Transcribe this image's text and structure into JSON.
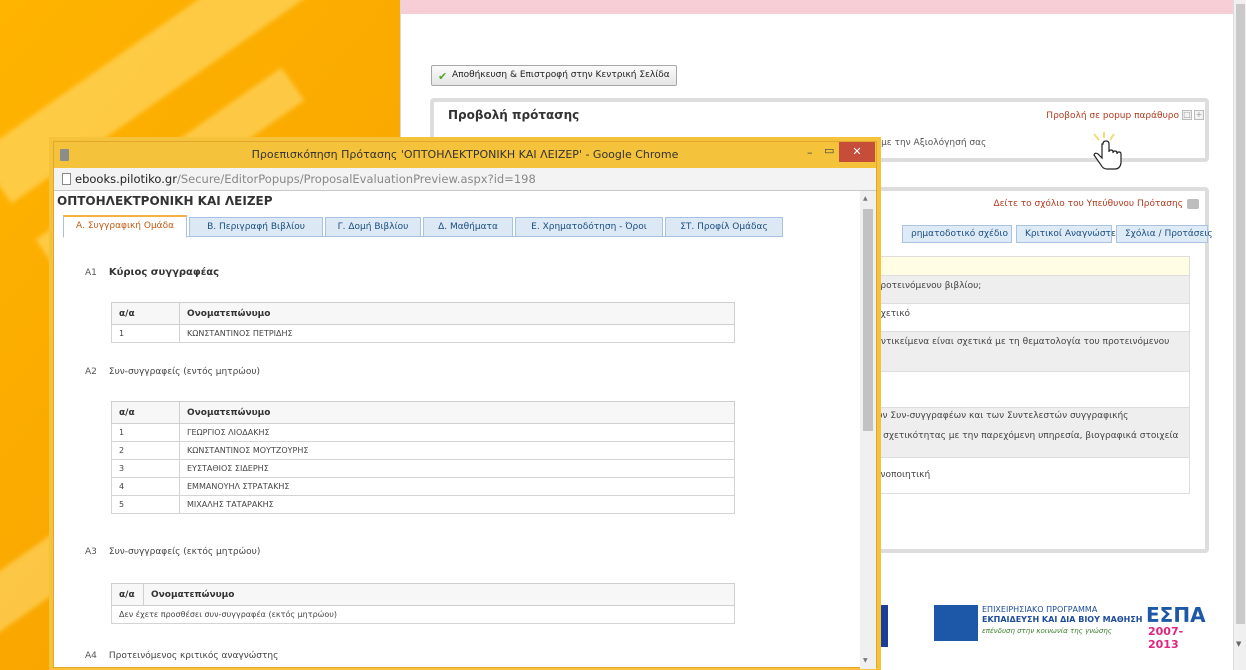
{
  "background_page": {
    "save_button": "Αποθήκευση & Επιστροφή στην Κεντρική Σελίδα",
    "preview_panel": {
      "title": "Προβολή πρότασης",
      "popup_link": "Προβολή σε popup παράθυρο",
      "hint": "Πατήστε εδώ για να δείτε την Πρόταση παράλληλα με την Αξιολόγησή σας"
    },
    "comments_panel": {
      "link": "Δείτε το σχόλιο του Υπεύθυνου Πρότασης",
      "tabs": [
        "ρηματοδοτικό σχέδιο",
        "Κριτικοί Αναγνώστες",
        "Σχόλια / Προτάσεις"
      ],
      "rows": [
        "προτεινόμενου βιβλίου;",
        "σχετικό",
        "αντικείμενα είναι σχετικά με τη θεματολογία του προτεινόμενου",
        "ων Συν-συγγραφέων και των Συντελεστών συγγραφικής",
        "ς σχετικότητας με την παρεχόμενη υπηρεσία, βιογραφικά στοιχεία",
        "ονοποιητική"
      ]
    },
    "footer": {
      "program_line1": "ΕΠΙΧΕΙΡΗΣΙΑΚΟ ΠΡΟΓΡΑΜΜΑ",
      "program_line2": "ΕΚΠΑΙΔΕΥΣΗ ΚΑΙ ΔΙΑ ΒΙΟΥ ΜΑΘΗΣΗ",
      "program_line3": "επένδυση στην κοινωνία της γνώσης",
      "espa_logo": "ΕΣΠΑ",
      "espa_years": "2007-2013"
    }
  },
  "popup": {
    "window_title": "Προεπισκόπηση Πρότασης 'ΟΠΤΟΗΛΕΚΤΡΟΝΙΚΗ ΚΑΙ ΛΕΙΖΕΡ' - Google Chrome",
    "url_domain": "ebooks.pilotiko.gr",
    "url_path": "/Secure/EditorPopups/ProposalEvaluationPreview.aspx?id=198",
    "doc_title": "ΟΠΤΟΗΛΕΚΤΡΟΝΙΚΗ ΚΑΙ ΛΕΙΖΕΡ",
    "tabs": [
      "Α. Συγγραφική Ομάδα",
      "Β. Περιγραφή Βιβλίου",
      "Γ. Δομή Βιβλίου",
      "Δ. Μαθήματα",
      "Ε. Χρηματοδότηση - Όροι",
      "ΣΤ. Προφίλ Ομάδας"
    ],
    "sections": {
      "a1": {
        "num": "Α1",
        "label": "Κύριος συγγραφέας"
      },
      "a2": {
        "num": "Α2",
        "label": "Συν-συγγραφείς (εντός μητρώου)"
      },
      "a3": {
        "num": "Α3",
        "label": "Συν-συγγραφείς (εκτός μητρώου)"
      },
      "a4": {
        "num": "Α4",
        "label": "Προτεινόμενος κριτικός αναγνώστης"
      }
    },
    "table_headers": {
      "index": "α/α",
      "name": "Ονοματεπώνυμο"
    },
    "main_author": [
      {
        "n": "1",
        "name": "ΚΩΝΣΤΑΝΤΙΝΟΣ ΠΕΤΡΙΔΗΣ"
      }
    ],
    "coauthors": [
      {
        "n": "1",
        "name": "ΓΕΩΡΓΙΟΣ ΛΙΟΔΑΚΗΣ"
      },
      {
        "n": "2",
        "name": "ΚΩΝΣΤΑΝΤΙΝΟΣ ΜΟΥΤΖΟΥΡΗΣ"
      },
      {
        "n": "3",
        "name": "ΕΥΣΤΑΘΙΟΣ ΣΙΔΕΡΗΣ"
      },
      {
        "n": "4",
        "name": "ΕΜΜΑΝΟΥΗΛ ΣΤΡΑΤΑΚΗΣ"
      },
      {
        "n": "5",
        "name": "ΜΙΧΑΛΗΣ ΤΑΤΑΡΑΚΗΣ"
      }
    ],
    "external_empty": "Δεν έχετε προσθέσει συν-συγγραφέα (εκτός μητρώου)"
  }
}
